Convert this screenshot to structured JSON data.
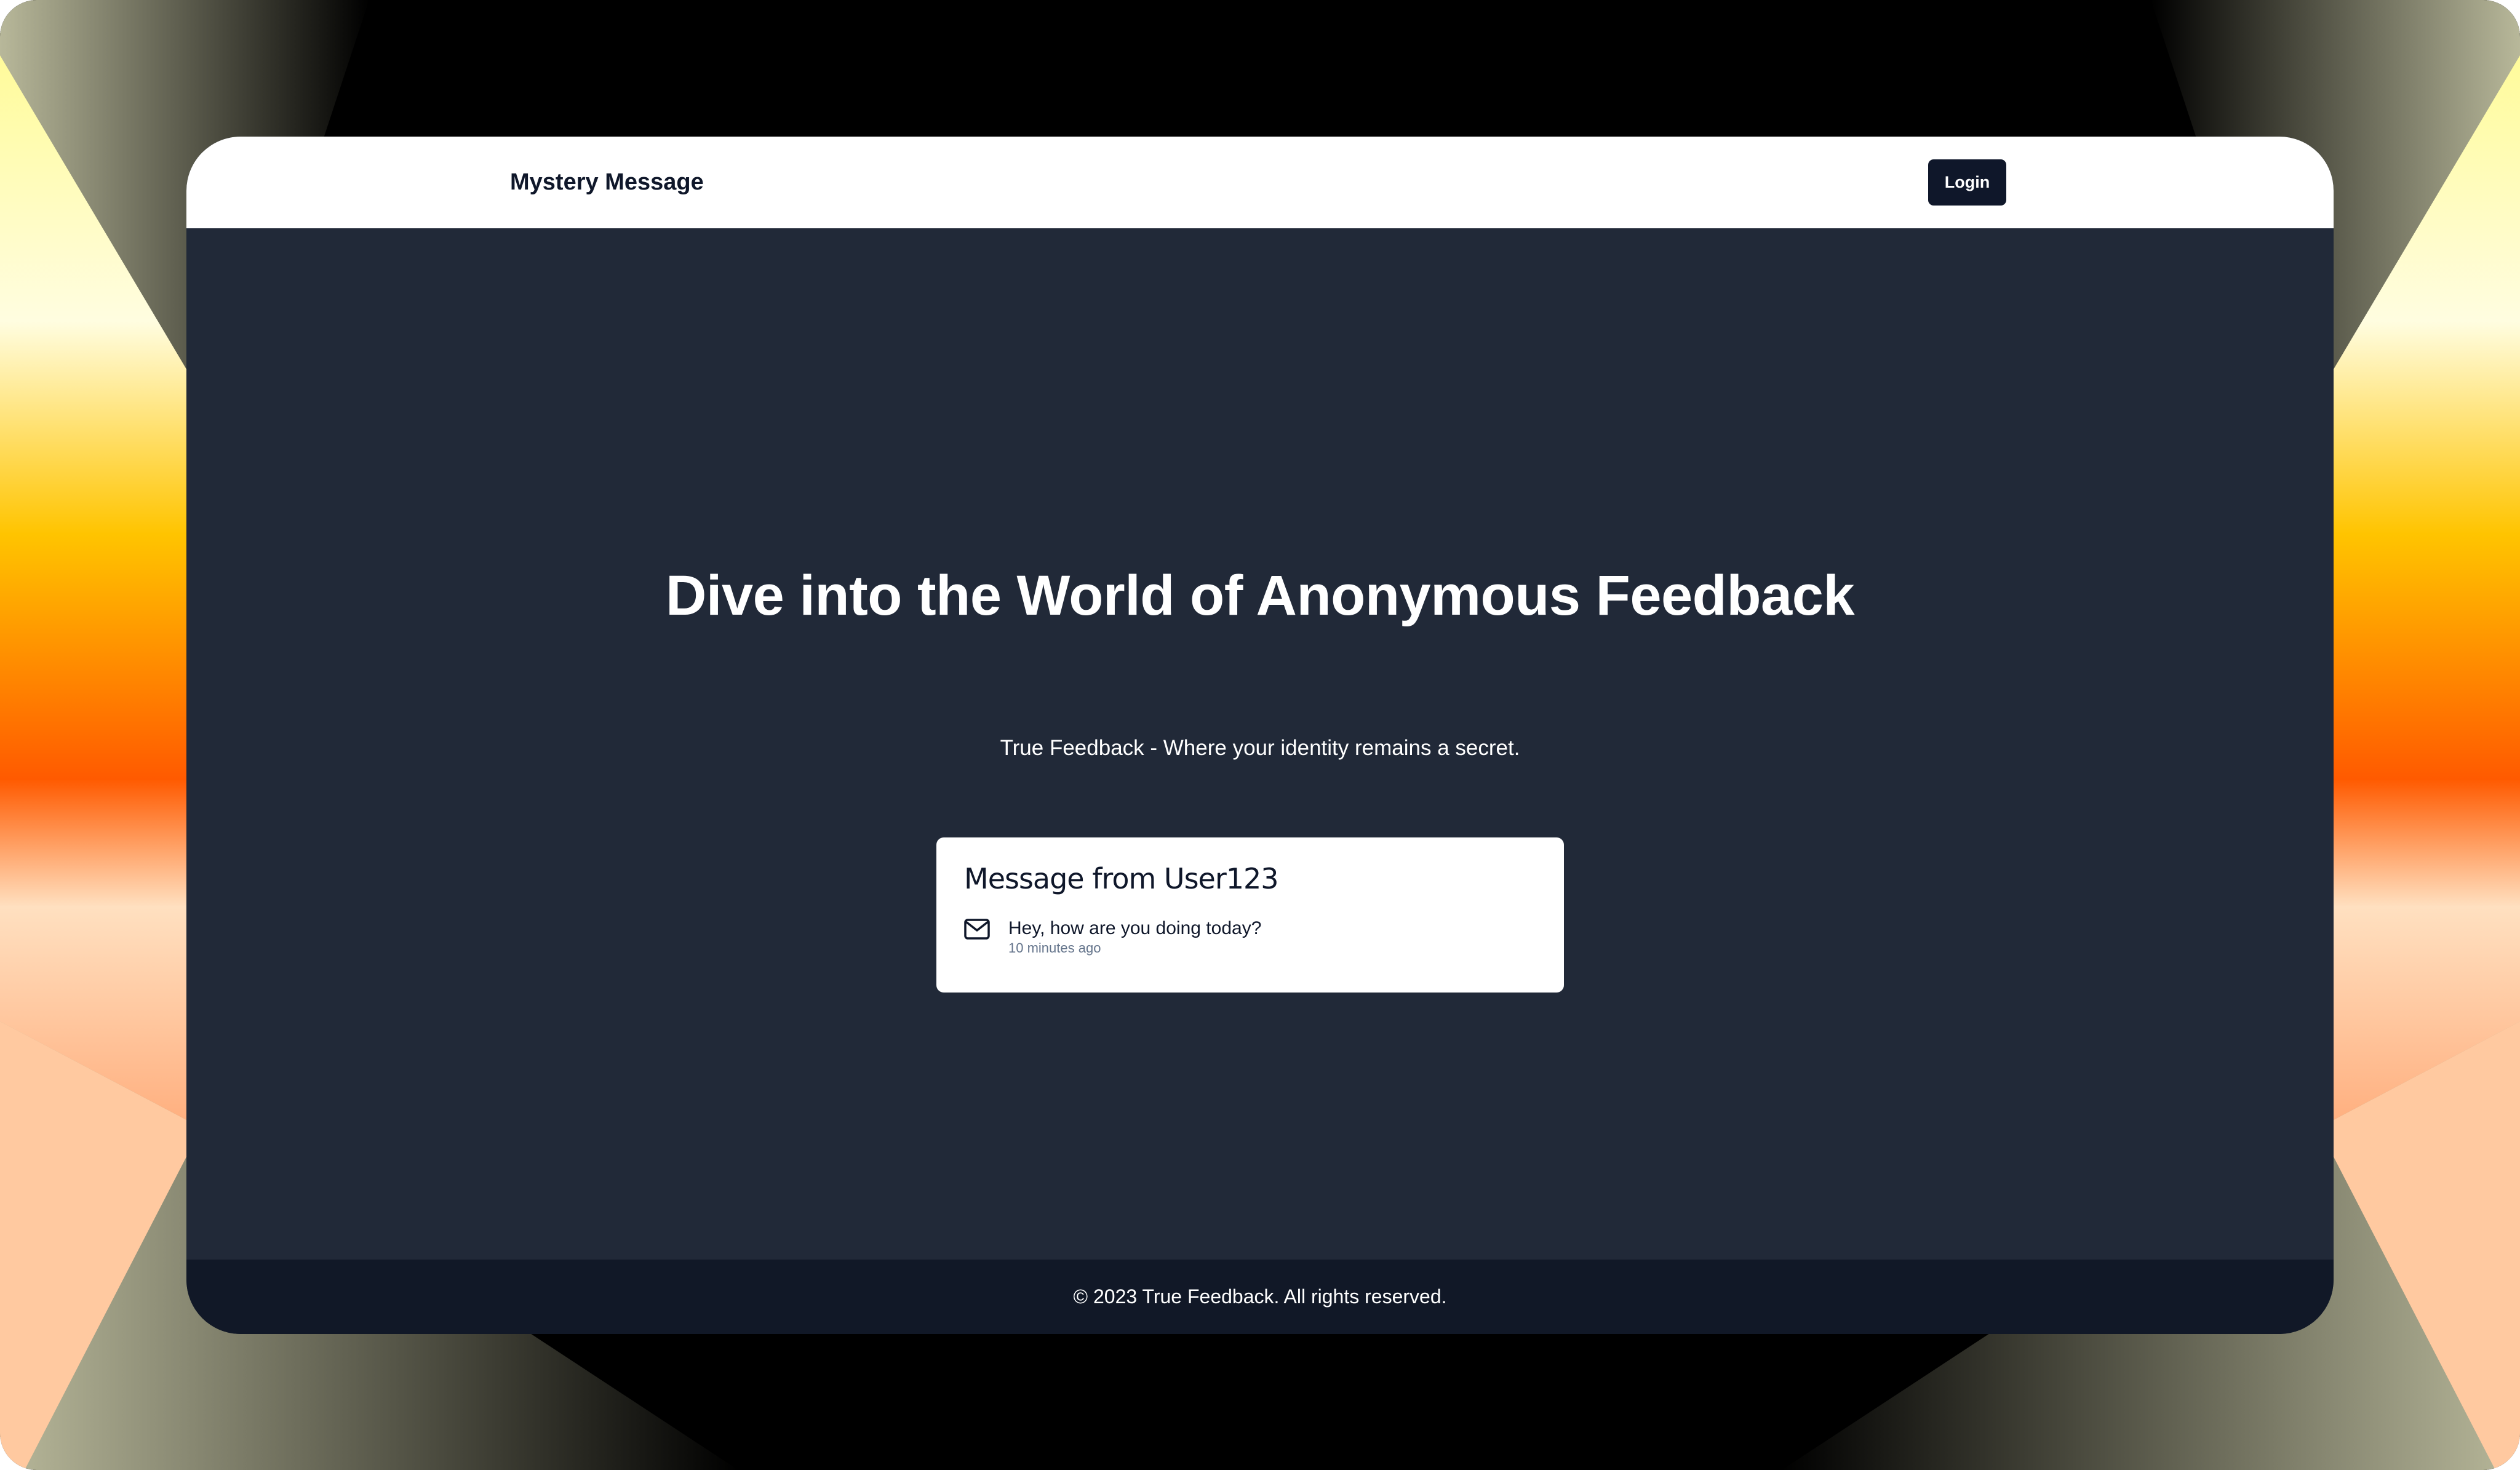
{
  "navbar": {
    "brand": "Mystery Message",
    "login_label": "Login"
  },
  "hero": {
    "title": "Dive into the World of Anonymous Feedback",
    "subtitle": "True Feedback - Where your identity remains a secret."
  },
  "message_card": {
    "title": "Message from User123",
    "icon": "mail-icon",
    "text": "Hey, how are you doing today?",
    "time": "10 minutes ago"
  },
  "footer": {
    "text": "© 2023 True Feedback. All rights reserved."
  },
  "colors": {
    "page_background": "#212938",
    "navbar_background": "#ffffff",
    "button_background": "#0f172a",
    "footer_background": "#111827",
    "wallpaper_accent": "#ff6a00"
  }
}
